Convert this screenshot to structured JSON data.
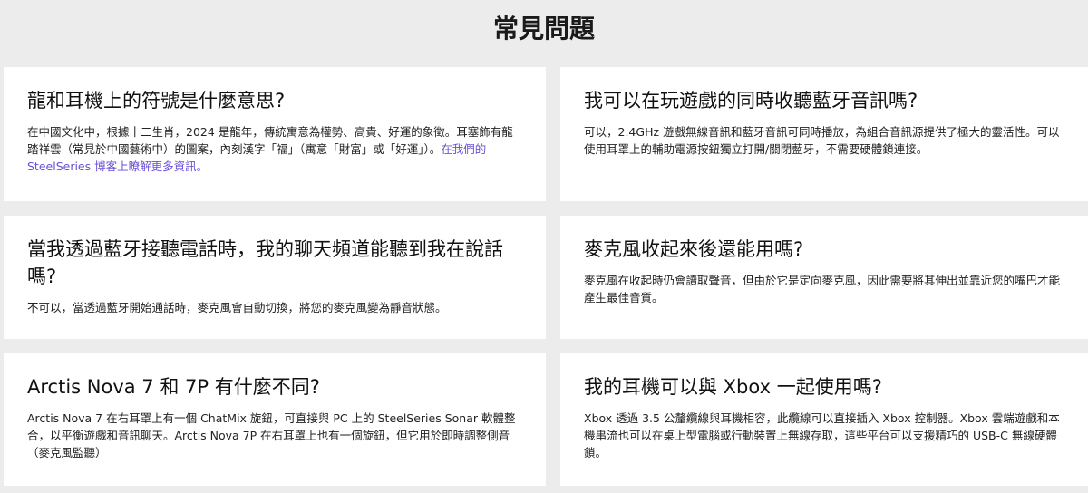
{
  "page": {
    "title": "常見問題"
  },
  "faq": [
    {
      "question": "龍和耳機上的符號是什麼意思?",
      "answer": "在中國文化中，根據十二生肖，2024 是龍年，傳統寓意為權勢、高貴、好運的象徵。耳塞飾有龍踏祥雲（常見於中國藝術中）的圖案，內刻漢字「福」（寓意「財富」或「好運」）。",
      "link_text": "在我們的 SteelSeries 博客上瞭解更多資訊。"
    },
    {
      "question": "我可以在玩遊戲的同時收聽藍牙音訊嗎?",
      "answer": "可以，2.4GHz 遊戲無線音訊和藍牙音訊可同時播放，為組合音訊源提供了極大的靈活性。可以使用耳罩上的輔助電源按鈕獨立打開/關閉藍牙，不需要硬體鎖連接。"
    },
    {
      "question": "當我透過藍牙接聽電話時，我的聊天頻道能聽到我在說話嗎?",
      "answer": "不可以，當透過藍牙開始通話時，麥克風會自動切換，將您的麥克風變為靜音狀態。"
    },
    {
      "question": "麥克風收起來後還能用嗎?",
      "answer": "麥克風在收起時仍會讀取聲音，但由於它是定向麥克風，因此需要將其伸出並靠近您的嘴巴才能產生最佳音質。"
    },
    {
      "question": "Arctis Nova 7 和 7P 有什麼不同?",
      "answer": "Arctis Nova 7 在右耳罩上有一個 ChatMix 旋鈕，可直接與 PC 上的 SteelSeries Sonar 軟體整合，以平衡遊戲和音訊聊天。Arctis Nova 7P 在右耳罩上也有一個旋鈕，但它用於即時調整側音（麥克風監聽）"
    },
    {
      "question": "我的耳機可以與 Xbox 一起使用嗎?",
      "answer": "Xbox 透過 3.5 公釐纜線與耳機相容，此纜線可以直接插入 Xbox 控制器。Xbox 雲端遊戲和本機串流也可以在桌上型電腦或行動裝置上無線存取，這些平台可以支援精巧的 USB-C 無線硬體鎖。"
    }
  ]
}
